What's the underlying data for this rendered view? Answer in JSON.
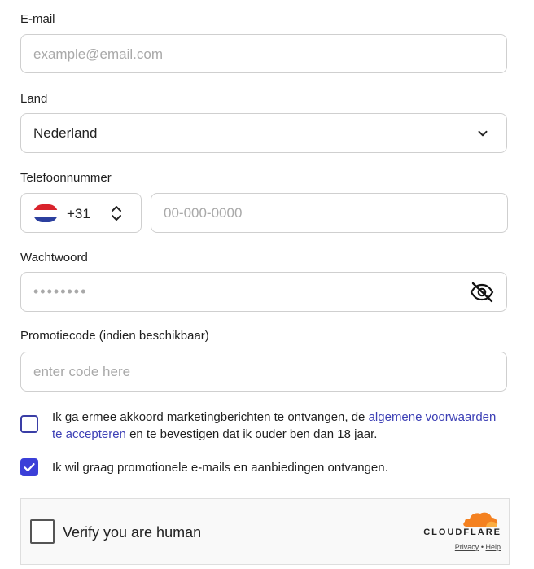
{
  "email": {
    "label": "E-mail",
    "placeholder": "example@email.com"
  },
  "country": {
    "label": "Land",
    "value": "Nederland"
  },
  "phone": {
    "label": "Telefoonnummer",
    "country_code": "+31",
    "placeholder": "00-000-0000"
  },
  "password": {
    "label": "Wachtwoord",
    "masked_value": "••••••••"
  },
  "promo": {
    "label": "Promotiecode (indien beschikbaar)",
    "placeholder": "enter code here"
  },
  "consent_terms": {
    "text_before": "Ik ga ermee akkoord marketingberichten te ontvangen, de ",
    "link_text": "algemene voorwaarden te accepteren",
    "text_after": " en te bevestigen dat ik ouder ben dan 18 jaar.",
    "checked": false
  },
  "consent_promo": {
    "text": "Ik wil graag promotionele e-mails en aanbiedingen ontvangen.",
    "checked": true
  },
  "captcha": {
    "label": "Verify you are human",
    "brand": "CLOUDFLARE",
    "privacy": "Privacy",
    "separator": "•",
    "help": "Help"
  },
  "colors": {
    "accent": "#3b3fd8",
    "link": "#3c3fb5",
    "cloudflare_orange": "#f48120"
  }
}
